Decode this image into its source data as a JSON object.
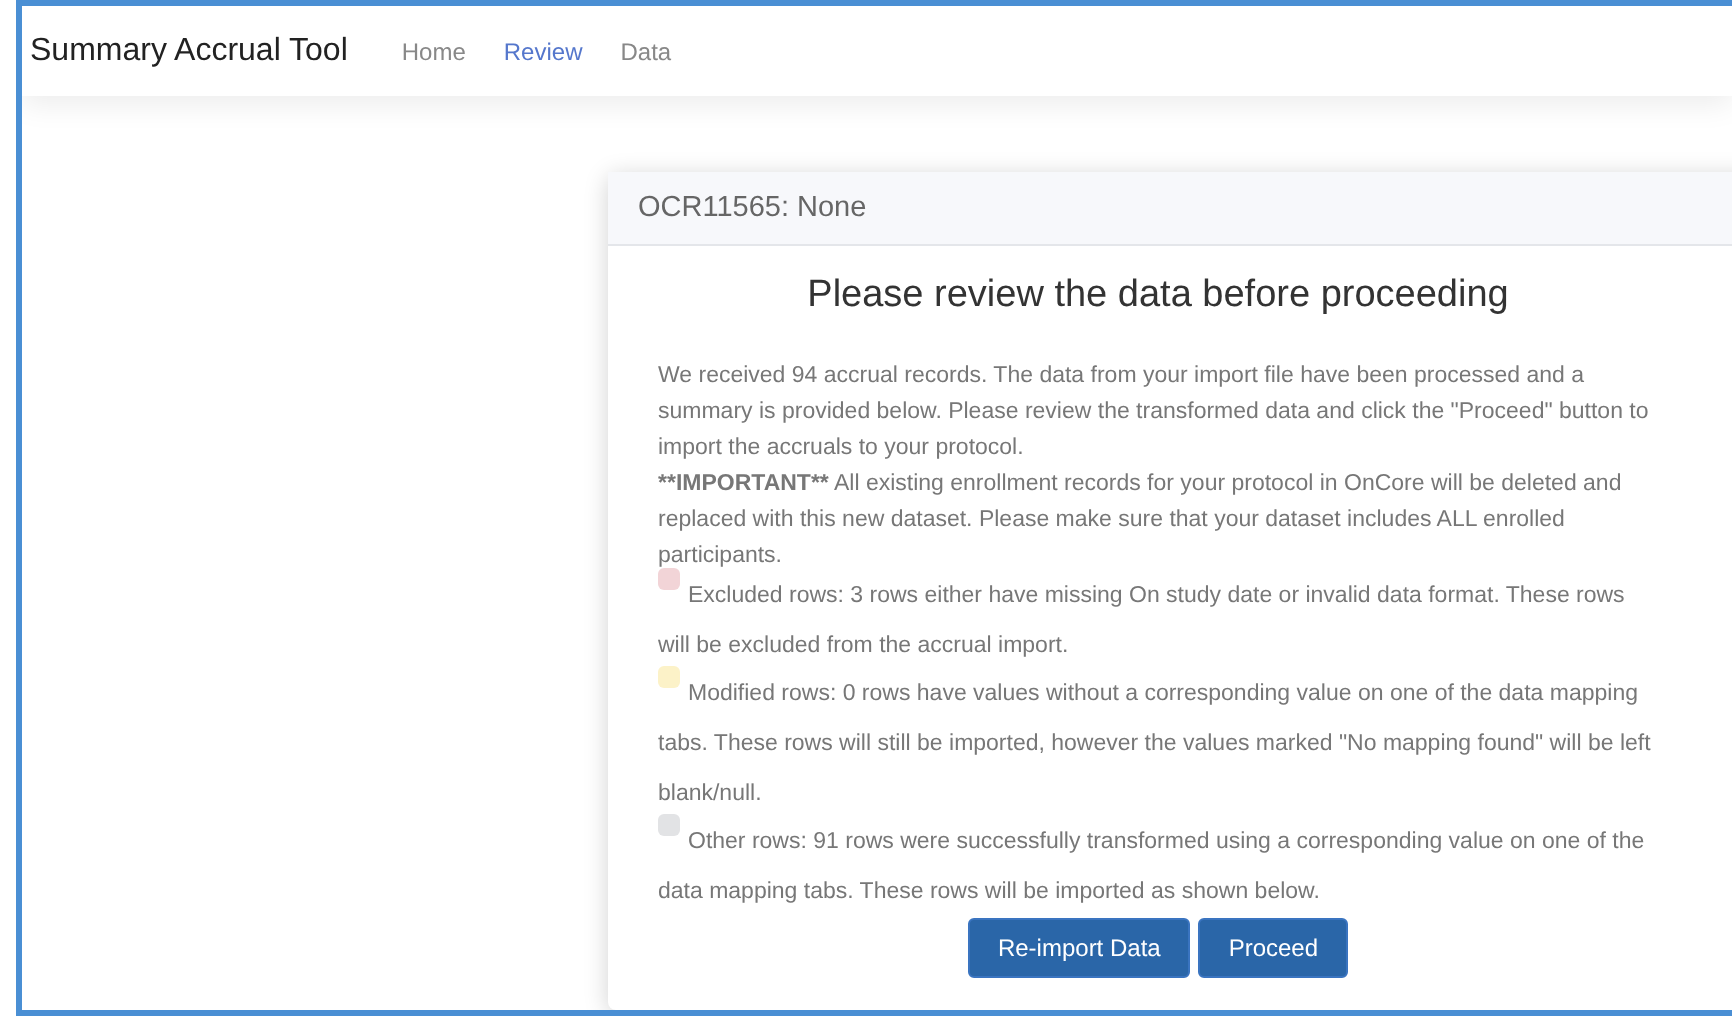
{
  "navbar": {
    "brand": "Summary Accrual Tool",
    "links": [
      {
        "label": "Home",
        "selected": false
      },
      {
        "label": "Review",
        "selected": true
      },
      {
        "label": "Data",
        "selected": false
      }
    ]
  },
  "card": {
    "header": "OCR11565: None",
    "heading": "Please review the data before proceeding",
    "intro": "We received 94 accrual records. The data from your import file have been processed and a summary is provided below. Please review the transformed data and click the \"Proceed\" button to import the accruals to your protocol.",
    "important_label": "**IMPORTANT**",
    "important": "All existing enrollment records for your protocol in OnCore will be deleted and replaced with this new dataset. Please make sure that your dataset includes ALL enrolled participants.",
    "legend": [
      {
        "color": "#f2d4d7",
        "text": "Excluded rows: 3 rows either have missing On study date or invalid data format. These rows will be excluded from the accrual import."
      },
      {
        "color": "#fcf2c8",
        "text": "Modified rows: 0 rows have values without a corresponding value on one of the data mapping tabs. These rows will still be imported, however the values marked \"No mapping found\" will be left blank/null."
      },
      {
        "color": "#e2e3e5",
        "text": "Other rows: 91 rows were successfully transformed using a corresponding value on one of the data mapping tabs. These rows will be imported as shown below."
      }
    ],
    "buttons": [
      "Re-import Data",
      "Proceed"
    ]
  }
}
